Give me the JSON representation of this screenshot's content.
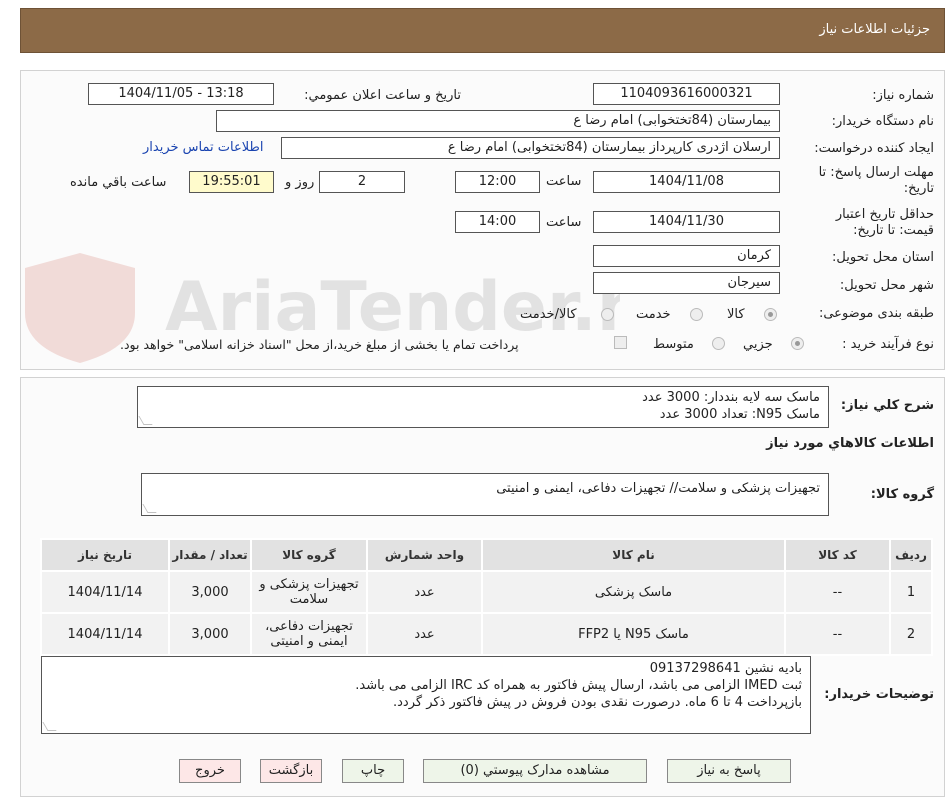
{
  "header": {
    "title": "جزئیات اطلاعات نیاز"
  },
  "form": {
    "need_number_label": "شماره نیاز:",
    "need_number": "1104093616000321",
    "announce_label": "تاریخ و ساعت اعلان عمومي:",
    "announce_value": "1404/11/05 - 13:18",
    "buyer_org_label": "نام دستگاه خريدار:",
    "buyer_org": "بیمارستان (84تختخوابی) امام رضا  ع",
    "creator_label": "ایجاد کننده درخواست:",
    "creator": "ارسلان اژدری کارپرداز بیمارستان (84تختخوابی) امام رضا  ع",
    "contact_link": "اطلاعات تماس خریدار",
    "deadline_label_line1": "مهلت ارسال پاسخ: تا",
    "deadline_label_line2": "تاریخ:",
    "deadline_date": "1404/11/08",
    "time_label": "ساعت",
    "deadline_time": "12:00",
    "days_value": "2",
    "days_label": "روز و",
    "remaining_time": "19:55:01",
    "remaining_label": "ساعت باقي مانده",
    "validity_label_line1": "حداقل تاریخ اعتبار",
    "validity_label_line2": "قیمت: تا تاریخ:",
    "validity_date": "1404/11/30",
    "validity_time": "14:00",
    "province_label": "استان محل تحویل:",
    "province": "کرمان",
    "city_label": "شهر محل تحویل:",
    "city": "سیرجان",
    "category_label": "طبقه بندی موضوعی:",
    "category_options": [
      "کالا",
      "خدمت",
      "کالا/خدمت"
    ],
    "process_label": "نوع فرآیند خرید :",
    "process_options": [
      "جزیي",
      "متوسط"
    ],
    "treasury_text": "پرداخت تمام یا بخشی از مبلغ خرید،از محل \"اسناد خزانه اسلامی\" خواهد بود."
  },
  "summary": {
    "label": "شرح کلي نياز:",
    "lines": [
      "ماسک سه لایه بنددار: 3000 عدد",
      "ماسک N95: تعداد 3000 عدد"
    ]
  },
  "goods_section": {
    "title": "اطلاعات کالاهاي مورد نياز",
    "group_label": "گروه کالا:",
    "group_value": "تجهیزات پزشکی و سلامت// تجهیزات دفاعی، ایمنی و امنیتی"
  },
  "table": {
    "headers": [
      "ردیف",
      "کد کالا",
      "نام کالا",
      "واحد شمارش",
      "گروه کالا",
      "تعداد / مقدار",
      "تاریخ نیاز"
    ],
    "rows": [
      {
        "row": "1",
        "code": "--",
        "name": "ماسک پزشکی",
        "unit": "عدد",
        "group": "تجهیزات پزشکی و سلامت",
        "qty": "3,000",
        "date": "1404/11/14"
      },
      {
        "row": "2",
        "code": "--",
        "name": "ماسک N95 یا FFP2",
        "unit": "عدد",
        "group": "تجهیزات دفاعی، ایمنی و امنیتی",
        "qty": "3,000",
        "date": "1404/11/14"
      }
    ]
  },
  "buyer_notes": {
    "label": "توضیحات خریدار:",
    "lines": [
      "بادیه نشین 09137298641",
      "ثبت IMED الزامی می باشد، ارسال پیش فاکتور به همراه کد IRC الزامی می باشد.",
      "بازپرداخت 4 تا 6 ماه. درصورت نقدی بودن فروش در پیش فاکتور ذکر گردد."
    ]
  },
  "buttons": {
    "reply": "پاسخ به نیاز",
    "attachments": "مشاهده مدارک پیوستي (0)",
    "print": "چاپ",
    "back": "بازگشت",
    "exit": "خروج"
  },
  "colors": {
    "header_bg": "#8c6a47",
    "link": "#1a44b0",
    "timer_bg": "#fffbcc"
  },
  "watermark": {
    "text": "AriaTender.neT"
  }
}
